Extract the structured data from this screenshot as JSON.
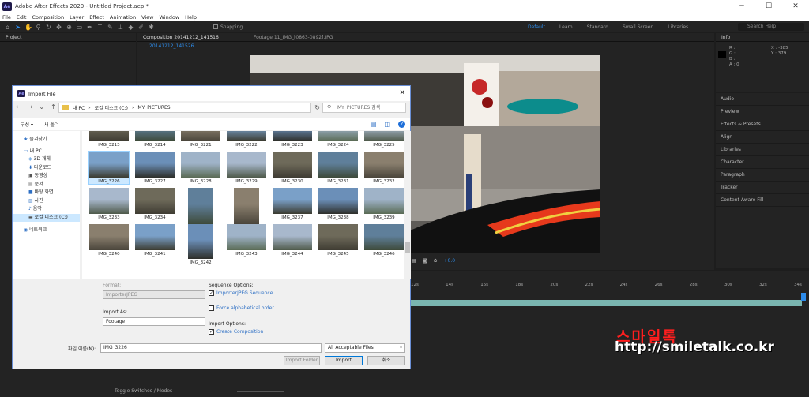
{
  "app": {
    "title": "Adobe After Effects 2020 - Untitled Project.aep *",
    "icon_text": "Ae",
    "menu": [
      "File",
      "Edit",
      "Composition",
      "Layer",
      "Effect",
      "Animation",
      "View",
      "Window",
      "Help"
    ],
    "snapping_label": "Snapping",
    "workspaces": [
      "Default",
      "Learn",
      "Standard",
      "Small Screen",
      "Libraries"
    ],
    "search_placeholder": "Search Help"
  },
  "panels": {
    "project_title": "Project",
    "composition_tab": "Composition 20141212_141516",
    "composition_sub": "20141212_141526",
    "footage_tab": "Footage 11_IMG_[0863-0892].JPG",
    "info_title": "Info",
    "info_values": {
      "r": "R :",
      "g": "G :",
      "b": "B :",
      "a": "A : 0",
      "x": "X : -385",
      "y": "Y : 379"
    },
    "right_panels": [
      "Audio",
      "Preview",
      "Effects & Presets",
      "Align",
      "Libraries",
      "Character",
      "Paragraph",
      "Tracker",
      "Content-Aware Fill"
    ],
    "viewer_zoom": "+0.0",
    "timeline_ticks": [
      "12s",
      "14s",
      "16s",
      "18s",
      "20s",
      "22s",
      "24s",
      "26s",
      "28s",
      "30s",
      "32s",
      "34s"
    ],
    "toggle_label": "Toggle Switches / Modes"
  },
  "dialog": {
    "title": "Import File",
    "path": [
      "내 PC",
      "로컬 디스크 (C:)",
      "MY_PICTURES"
    ],
    "search_placeholder": "MY_PICTURES 검색",
    "cmd_organize": "구성 ▾",
    "cmd_new_folder": "새 폴더",
    "nav_items": [
      {
        "label": "즐겨찾기",
        "icon": "star-icon"
      },
      {
        "label": "내 PC",
        "icon": "pc-icon"
      },
      {
        "label": "3D 개체",
        "icon": "cube-icon"
      },
      {
        "label": "다운로드",
        "icon": "download-icon"
      },
      {
        "label": "동영상",
        "icon": "video-icon"
      },
      {
        "label": "문서",
        "icon": "document-icon"
      },
      {
        "label": "바탕 화면",
        "icon": "desktop-icon"
      },
      {
        "label": "사진",
        "icon": "picture-icon"
      },
      {
        "label": "음악",
        "icon": "music-icon"
      },
      {
        "label": "로컬 디스크 (C:)",
        "icon": "disk-icon"
      },
      {
        "label": "네트워크",
        "icon": "network-icon"
      }
    ],
    "rows": [
      [
        "IMG_3213",
        "IMG_3214",
        "IMG_3221",
        "IMG_3222",
        "IMG_3223",
        "IMG_3224",
        "IMG_3225"
      ],
      [
        "IMG_3226",
        "IMG_3227",
        "IMG_3228",
        "IMG_3229",
        "IMG_3230",
        "IMG_3231",
        "IMG_3232"
      ],
      [
        "IMG_3233",
        "IMG_3234",
        "IMG_3235",
        "IMG_3236",
        "IMG_3237",
        "IMG_3238",
        "IMG_3239"
      ],
      [
        "IMG_3240",
        "IMG_3241",
        "IMG_3242",
        "IMG_3243",
        "IMG_3244",
        "IMG_3245",
        "IMG_3246"
      ]
    ],
    "format_label": "Format:",
    "format_value": "ImporterJPEG",
    "import_as_label": "Import As:",
    "import_as_value": "Footage",
    "sequence_label": "Sequence Options:",
    "sequence_check": "ImporterJPEG Sequence",
    "force_alpha": "Force alphabetical order",
    "import_options_label": "Import Options:",
    "create_comp": "Create Composition",
    "filename_label": "파일 이름(N):",
    "filename_value": "IMG_3226",
    "filetype_value": "All Acceptable Files",
    "btn_import_folder": "Import Folder",
    "btn_import": "Import",
    "btn_cancel": "취소"
  },
  "watermark": {
    "line1": "스마일톡",
    "line2": "http://smiletalk.co.kr"
  }
}
